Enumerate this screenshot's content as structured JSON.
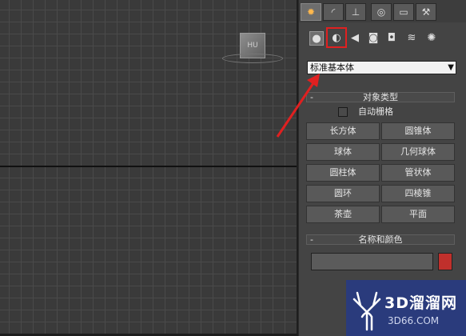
{
  "viewport": {
    "cube_label": "HU"
  },
  "panel": {
    "tabs": [
      {
        "name": "create",
        "glyph": "✹"
      },
      {
        "name": "modify",
        "glyph": "◜"
      },
      {
        "name": "hierarchy",
        "glyph": "⊥"
      },
      {
        "name": "motion",
        "glyph": "◎"
      },
      {
        "name": "display",
        "glyph": "▭"
      },
      {
        "name": "utilities",
        "glyph": "⚒"
      }
    ],
    "create_icons": [
      {
        "name": "geometry",
        "glyph": "●"
      },
      {
        "name": "shapes",
        "glyph": "◐"
      },
      {
        "name": "lights",
        "glyph": "◀"
      },
      {
        "name": "cameras",
        "glyph": "◙"
      },
      {
        "name": "helpers",
        "glyph": "◘"
      },
      {
        "name": "space-warps",
        "glyph": "≋"
      },
      {
        "name": "systems",
        "glyph": "✺"
      }
    ],
    "dropdown_value": "标准基本体",
    "object_type": {
      "title": "对象类型",
      "minus": "-",
      "autogrid_label": "自动栅格",
      "buttons": [
        "长方体",
        "圆锥体",
        "球体",
        "几何球体",
        "圆柱体",
        "管状体",
        "圆环",
        "四棱锥",
        "茶壶",
        "平面"
      ]
    },
    "name_color": {
      "title": "名称和颜色",
      "minus": "-",
      "swatch_color": "#c0302c"
    }
  },
  "watermark": {
    "title": "3D溜溜网",
    "subtitle": "3D66.COM"
  },
  "accent": {
    "highlight_red": "#e02020"
  }
}
